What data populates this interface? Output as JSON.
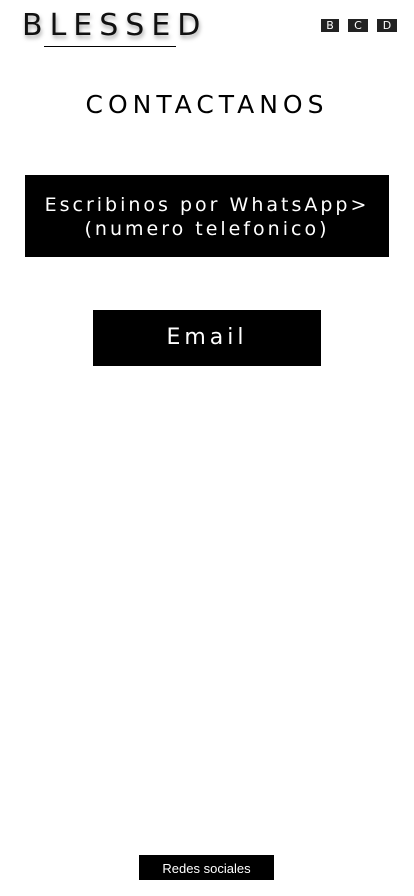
{
  "header": {
    "logo_text": "BLESSED",
    "nav": [
      {
        "label": "B"
      },
      {
        "label": "C"
      },
      {
        "label": "D"
      }
    ]
  },
  "main": {
    "title": "CONTACTANOS",
    "whatsapp_button": {
      "line1": "Escribinos por WhatsApp>",
      "line2": "(numero telefonico)"
    },
    "email_button": {
      "label": "Email"
    }
  },
  "footer": {
    "social_label": "Redes sociales"
  },
  "colors": {
    "background": "#ffffff",
    "primary": "#000000",
    "button_text": "#ffffff"
  }
}
